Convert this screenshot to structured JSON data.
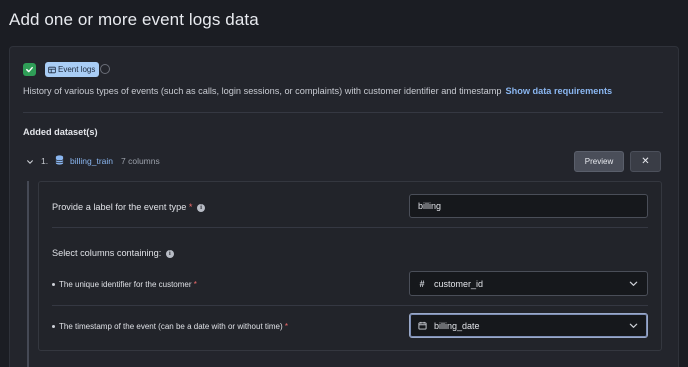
{
  "page": {
    "title": "Add one or more event logs data"
  },
  "header_chip": {
    "label": "Event logs",
    "icon": "table-icon"
  },
  "description": {
    "text": "History of various types of events (such as calls, login sessions, or complaints) with customer identifier and timestamp",
    "link": "Show data requirements"
  },
  "datasets_section": {
    "title": "Added dataset(s)"
  },
  "dataset": {
    "index": "1.",
    "name": "billing_train",
    "columns": "7 columns",
    "preview_label": "Preview",
    "remove_label": "✕"
  },
  "event_type": {
    "label": "Provide a label for the event type",
    "required_mark": "*",
    "value": "billing"
  },
  "columns_section": {
    "label": "Select columns containing:"
  },
  "customer_id_field": {
    "label": "The unique identifier for the customer",
    "required_mark": "*",
    "value": "customer_id",
    "icon": "hash-icon"
  },
  "timestamp_field": {
    "label": "The timestamp of the event (can be a date with or without time)",
    "required_mark": "*",
    "value": "billing_date",
    "icon": "calendar-icon"
  },
  "colors": {
    "background": "#1b1d23",
    "panel": "#23252c",
    "link": "#8ab6f0",
    "success": "#2f9e57",
    "chip": "#a9cdf5",
    "required": "#ef6b6b"
  }
}
